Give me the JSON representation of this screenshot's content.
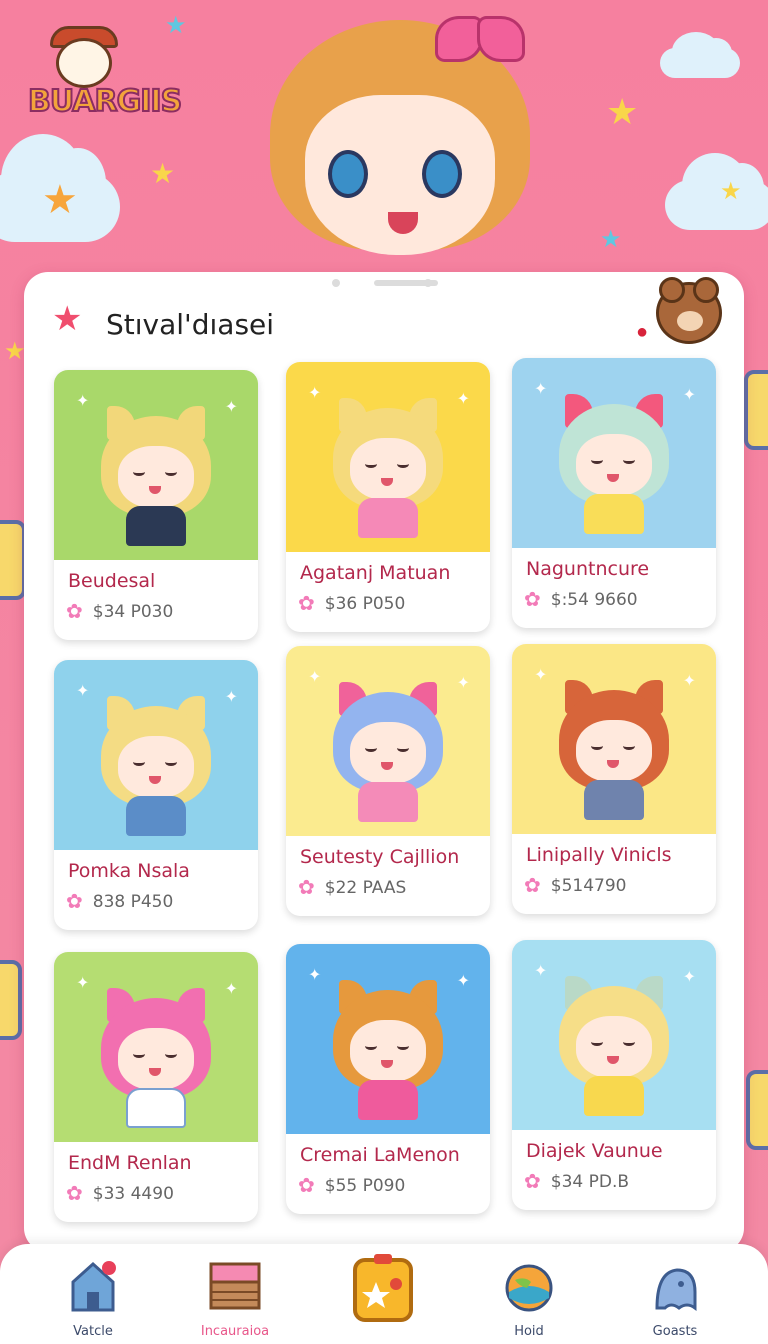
{
  "app": {
    "logo_text": "BUARGIIS",
    "accent": "#f47a9a"
  },
  "panel": {
    "title": "Stıval'dıasei",
    "title_icon": "star-icon"
  },
  "cards": [
    {
      "name": "Beudesal",
      "price": "$34 P030",
      "bg": "#a9d86a",
      "hair": "#f2d77a",
      "ear": "#f2d77a",
      "body": "#2b3954"
    },
    {
      "name": "Agatanj Matuan",
      "price": "$36 P050",
      "bg": "#fbd94a",
      "hair": "#f5da7c",
      "ear": "#f5da7c",
      "body": "#f589b7"
    },
    {
      "name": "Naguntncure",
      "price": "$:54 9660",
      "bg": "#9ed3ef",
      "hair": "#bfe4d6",
      "ear": "#f3587d",
      "body": "#f9dd58"
    },
    {
      "name": "Pomka Nsala",
      "price": "838 P450",
      "bg": "#8fd2ec",
      "hair": "#f4dc84",
      "ear": "#f4dc84",
      "body": "#5b8dc8"
    },
    {
      "name": "Seutesty Cajllion",
      "price": "$22 PAAS",
      "bg": "#fbeb8f",
      "hair": "#93b4ef",
      "ear": "#f0629a",
      "body": "#f48bb8"
    },
    {
      "name": "Linipally Vinicls",
      "price": "$514790",
      "bg": "#fbe786",
      "hair": "#d7653a",
      "ear": "#d7653a",
      "body": "#6f83ad"
    },
    {
      "name": "EndM Renlan",
      "price": "$33 4490",
      "bg": "#b5dd72",
      "hair": "#f26fb0",
      "ear": "#f26fb0",
      "body": "#ffffff"
    },
    {
      "name": "Cremai LaMenon",
      "price": "$55 P090",
      "bg": "#62b3ec",
      "hair": "#e6993d",
      "ear": "#e6993d",
      "body": "#ef5b9c"
    },
    {
      "name": "Diajek Vaunue",
      "price": "$34 PD.B",
      "bg": "#a7dff2",
      "hair": "#f6de88",
      "ear": "#b9d9c7",
      "body": "#f8d84e"
    }
  ],
  "nav": {
    "items": [
      {
        "label": "Vatcle",
        "icon": "home-icon",
        "active": false
      },
      {
        "label": "Incauraioa",
        "icon": "shop-icon",
        "active": true
      },
      {
        "label": "",
        "icon": "card-icon",
        "active": false
      },
      {
        "label": "Hoid",
        "icon": "globe-icon",
        "active": false
      },
      {
        "label": "Goasts",
        "icon": "ghost-icon",
        "active": false
      }
    ]
  }
}
